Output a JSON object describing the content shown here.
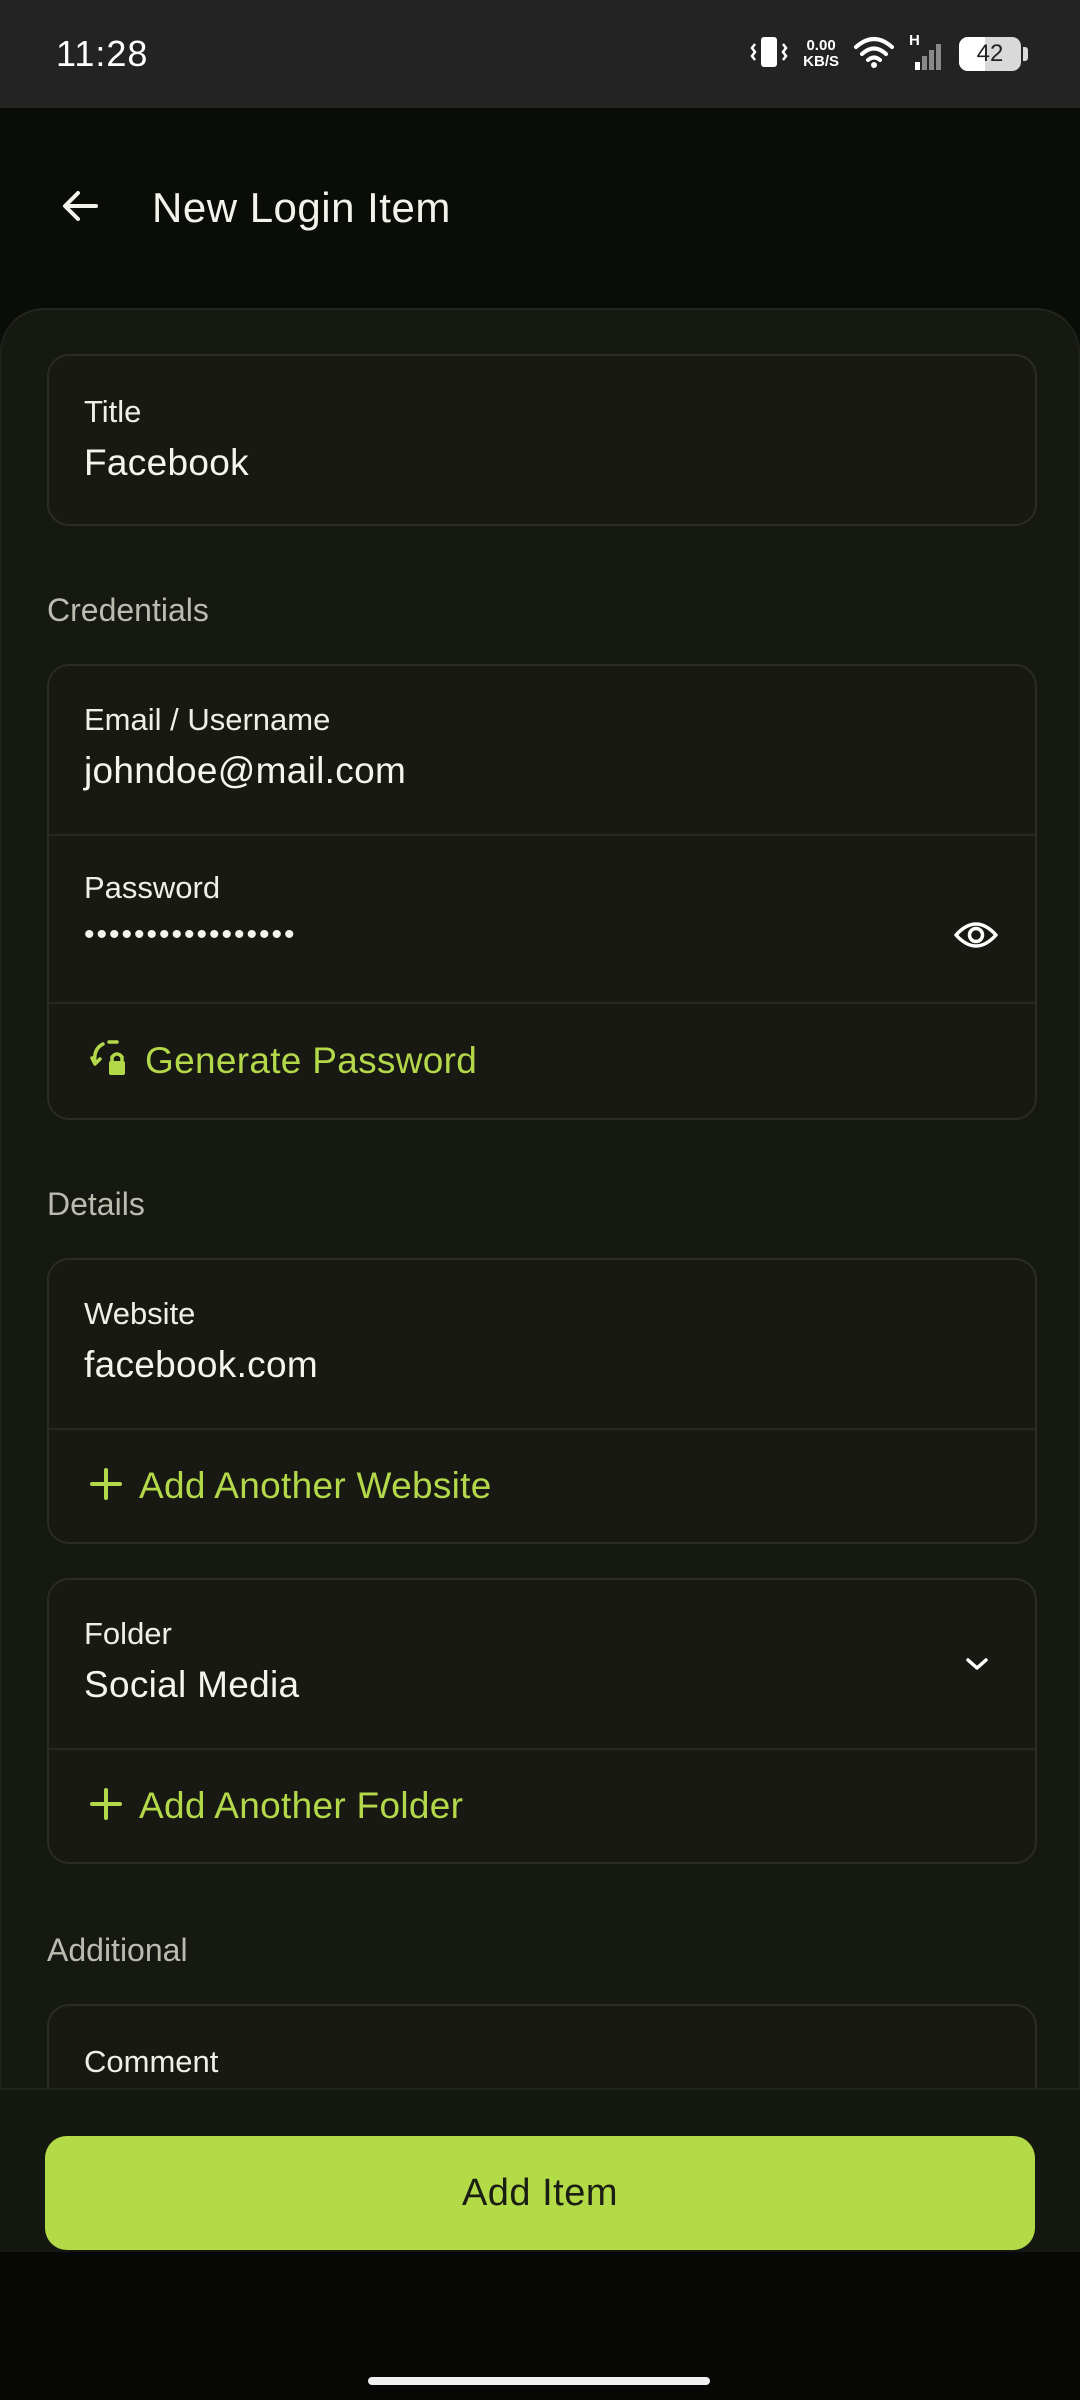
{
  "status_bar": {
    "time": "11:28",
    "net_speed_value": "0.00",
    "net_speed_unit": "KB/S",
    "network_type": "H",
    "battery": "42"
  },
  "app_bar": {
    "title": "New Login Item",
    "back_icon": "arrow-left-icon"
  },
  "title_field": {
    "label": "Title",
    "value": "Facebook"
  },
  "credentials": {
    "section_label": "Credentials",
    "email": {
      "label": "Email / Username",
      "value": "johndoe@mail.com"
    },
    "password": {
      "label": "Password",
      "value": "•••••••••••••••••",
      "toggle_icon": "eye-icon"
    },
    "generate_label": "Generate Password",
    "generate_icon": "regenerate-lock-icon"
  },
  "details": {
    "section_label": "Details",
    "website": {
      "label": "Website",
      "value": "facebook.com"
    },
    "add_website_label": "Add Another Website",
    "folder": {
      "label": "Folder",
      "value": "Social Media",
      "dropdown_icon": "chevron-down-icon"
    },
    "add_folder_label": "Add Another Folder"
  },
  "additional": {
    "section_label": "Additional",
    "comment": {
      "label": "Comment"
    }
  },
  "primary_action": {
    "label": "Add Item"
  },
  "colors": {
    "accent": "#b3da47",
    "background": "#0a0c08",
    "surface": "#161812",
    "border": "#2a2d24"
  }
}
